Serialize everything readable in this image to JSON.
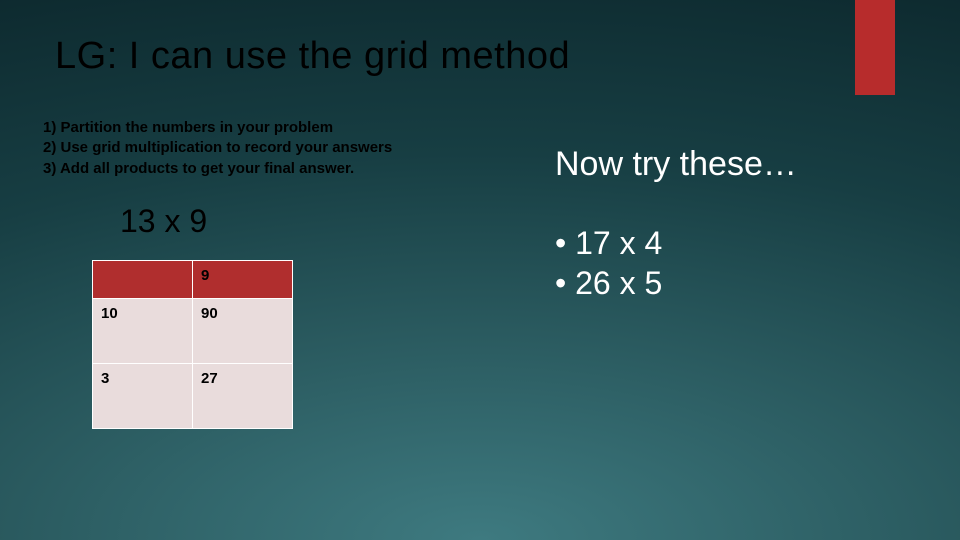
{
  "title": "LG: I can use the grid method",
  "steps": [
    "1)  Partition the numbers in your problem",
    "2)  Use grid multiplication to record your answers",
    "3)  Add all products to get your final answer."
  ],
  "example": {
    "expression": "13 x 9",
    "grid": {
      "col_header": "9",
      "rows": [
        {
          "label": "10",
          "value": "90"
        },
        {
          "label": "3",
          "value": "27"
        }
      ]
    }
  },
  "now_try_heading": "Now try these…",
  "try_items": [
    "17 x 4",
    "26 x 5"
  ],
  "colors": {
    "accent": "#b72c2c"
  }
}
